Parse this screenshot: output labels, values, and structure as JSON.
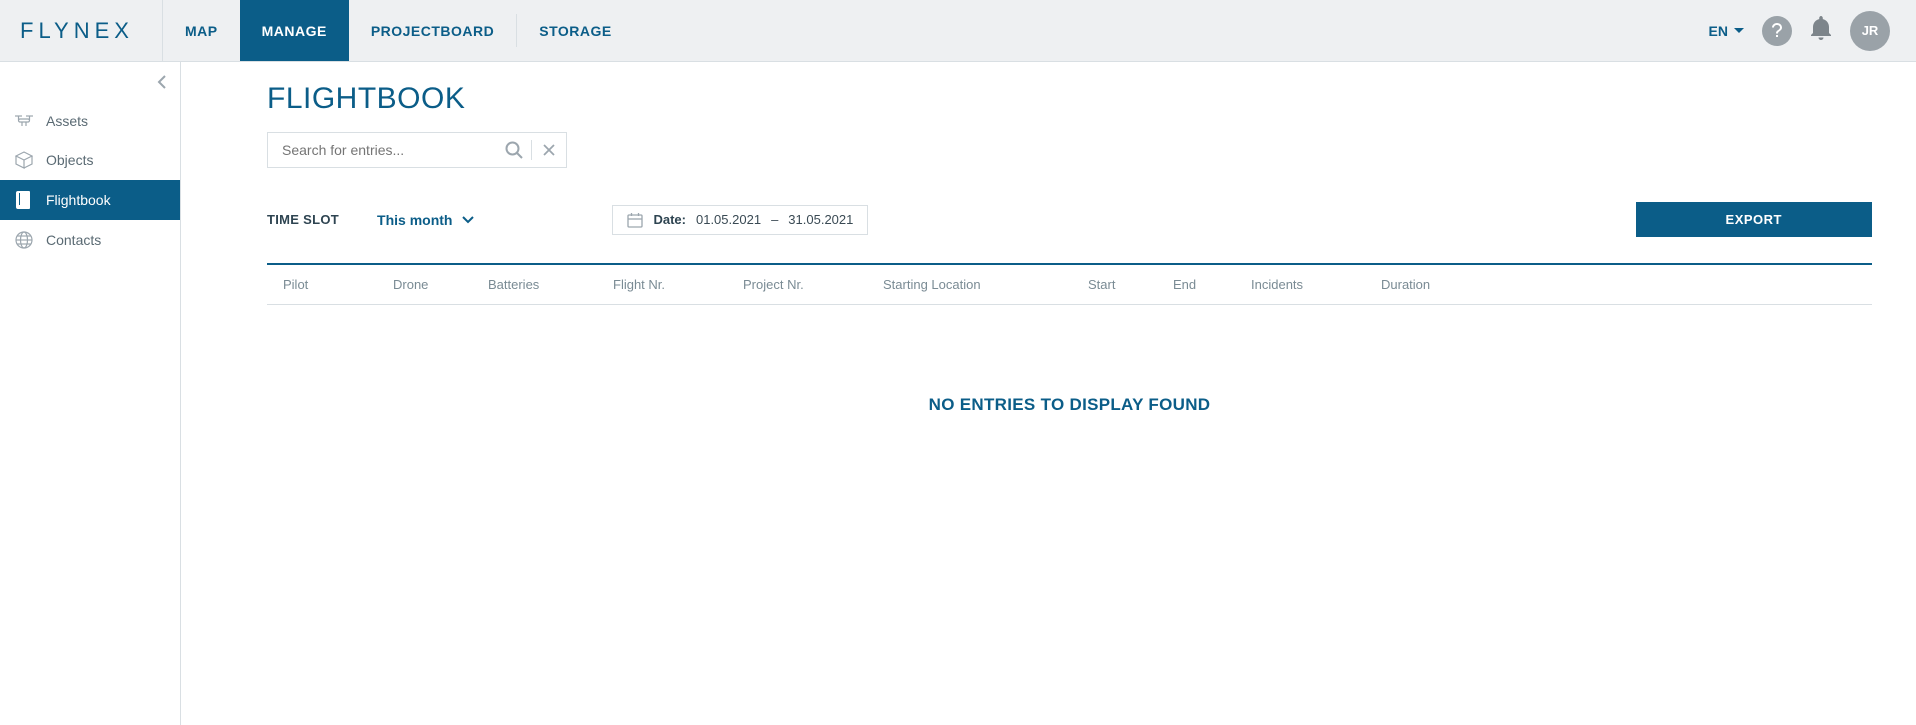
{
  "header": {
    "logo": "FLYNEX",
    "nav": [
      {
        "label": "MAP",
        "active": false
      },
      {
        "label": "MANAGE",
        "active": true
      },
      {
        "label": "PROJECTBOARD",
        "active": false
      },
      {
        "label": "STORAGE",
        "active": false
      }
    ],
    "lang": "EN",
    "avatar_initials": "JR"
  },
  "sidebar": {
    "items": [
      {
        "icon": "drone-icon",
        "label": "Assets",
        "active": false
      },
      {
        "icon": "cube-icon",
        "label": "Objects",
        "active": false
      },
      {
        "icon": "book-icon",
        "label": "Flightbook",
        "active": true
      },
      {
        "icon": "globe-icon",
        "label": "Contacts",
        "active": false
      }
    ]
  },
  "page": {
    "title": "FLIGHTBOOK",
    "search_placeholder": "Search for entries...",
    "time_slot_label": "TIME SLOT",
    "time_slot_value": "This month",
    "date_label": "Date:",
    "date_from": "01.05.2021",
    "date_sep": "–",
    "date_to": "31.05.2021",
    "export_label": "EXPORT",
    "columns": [
      "Pilot",
      "Drone",
      "Batteries",
      "Flight Nr.",
      "Project Nr.",
      "Starting Location",
      "Start",
      "End",
      "Incidents",
      "Duration"
    ],
    "empty_message": "NO ENTRIES TO DISPLAY FOUND"
  }
}
